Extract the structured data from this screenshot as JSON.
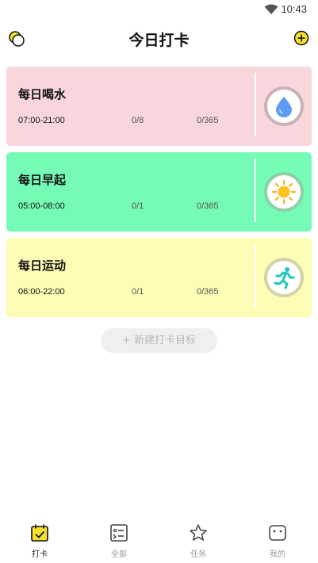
{
  "status_bar": {
    "time": "10:43"
  },
  "header": {
    "title": "今日打卡"
  },
  "habits": [
    {
      "name": "每日喝水",
      "time_range": "07:00-21:00",
      "count": "0/8",
      "total": "0/365",
      "icon": "water-drop-icon",
      "bg": "#f9d5dc",
      "ring": "#c8b4b8"
    },
    {
      "name": "每日早起",
      "time_range": "05:00-08:00",
      "count": "0/1",
      "total": "0/365",
      "icon": "sun-icon",
      "bg": "#75fbb5",
      "ring": "#8fcfa9"
    },
    {
      "name": "每日运动",
      "time_range": "06:00-22:00",
      "count": "0/1",
      "total": "0/365",
      "icon": "running-icon",
      "bg": "#fefdb6",
      "ring": "#d4d2a8"
    }
  ],
  "new_button": {
    "label": "+ 新建打卡目标"
  },
  "tabs": [
    {
      "label": "打卡",
      "icon": "calendar-check-icon",
      "active": true
    },
    {
      "label": "全部",
      "icon": "list-icon",
      "active": false
    },
    {
      "label": "任务",
      "icon": "star-icon",
      "active": false
    },
    {
      "label": "我的",
      "icon": "face-icon",
      "active": false
    }
  ]
}
